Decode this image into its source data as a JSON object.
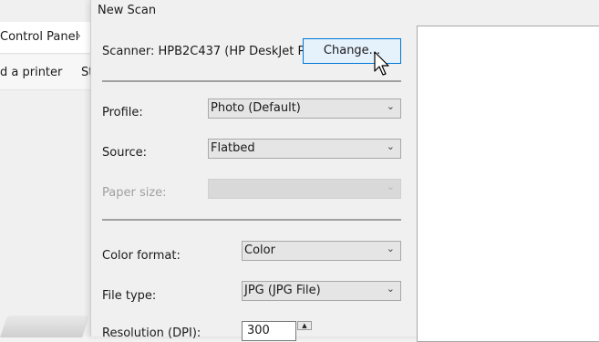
{
  "background_window": {
    "breadcrumb": "Control Panel",
    "breadcrumb_chevron": "›",
    "add_printer": "d a printer",
    "truncated": "St"
  },
  "dialog": {
    "title": "New Scan",
    "scanner_label": "Scanner: HPB2C437 (HP DeskJet Pl...",
    "change_button": "Change...",
    "profile": {
      "label": "Profile:",
      "value": "Photo (Default)"
    },
    "source": {
      "label": "Source:",
      "value": "Flatbed"
    },
    "paper_size": {
      "label": "Paper size:",
      "value": ""
    },
    "color_format": {
      "label": "Color format:",
      "value": "Color"
    },
    "file_type": {
      "label": "File type:",
      "value": "JPG (JPG File)"
    },
    "resolution": {
      "label": "Resolution (DPI):",
      "value": "300"
    }
  },
  "icons": {
    "dropdown": "chevron-down-icon",
    "spinner_up": "spinner-up-icon",
    "cursor": "mouse-pointer-icon"
  },
  "colors": {
    "accent": "#0078d7",
    "button_bg": "#e5f1fb",
    "dialog_bg": "#f0f0f0",
    "preview_bg": "#ffffff"
  }
}
